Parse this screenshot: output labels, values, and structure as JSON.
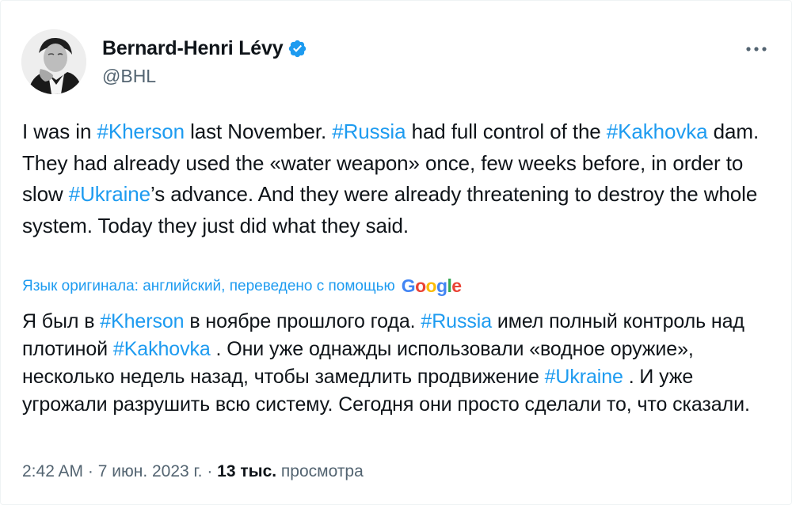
{
  "author": {
    "display_name": "Bernard-Henri Lévy",
    "handle": "@BHL",
    "verified_icon": "verified-badge-icon",
    "avatar_icon": "profile-photo-avatar"
  },
  "more_icon": "more-horizontal-icon",
  "tweet": {
    "original": {
      "line1_a": "I was in ",
      "tag_kherson": "#Kherson",
      "line1_b": " last November. ",
      "tag_russia": "#Russia",
      "line1_c": " had full control of the ",
      "tag_kakhovka": "#Kakhovka",
      "line2_a": " dam. They had already used the «water weapon» once, few weeks before, in order to slow ",
      "tag_ukraine": "#Ukraine",
      "line3_a": "’s advance. And they were already threatening to destroy the whole system. Today they just did what they said."
    },
    "translation_note": "Язык оригинала: английский, переведено с помощью",
    "translation_provider": [
      "G",
      "o",
      "o",
      "g",
      "l",
      "e"
    ],
    "translated": {
      "p1": "Я был в ",
      "tag_kherson": "#Kherson",
      "p2": " в ноябре прошлого года. ",
      "tag_russia": "#Russia",
      "p3": " имел полный контроль над плотиной ",
      "tag_kakhovka": "#Kakhovka",
      "p4": " . Они уже однажды использовали «водное оружие», несколько недель назад, чтобы замедлить продвижение ",
      "tag_ukraine": "#Ukraine",
      "p5": " . И уже угрожали разрушить всю систему. Сегодня они просто сделали то, что сказали."
    }
  },
  "meta": {
    "time": "2:42 AM",
    "separator": " · ",
    "date": "7 июн. 2023 г.",
    "views_count": "13 тыс.",
    "views_label": " просмотра"
  },
  "colors": {
    "link": "#1d9bf0",
    "text": "#0f1419",
    "secondary": "#536471"
  }
}
